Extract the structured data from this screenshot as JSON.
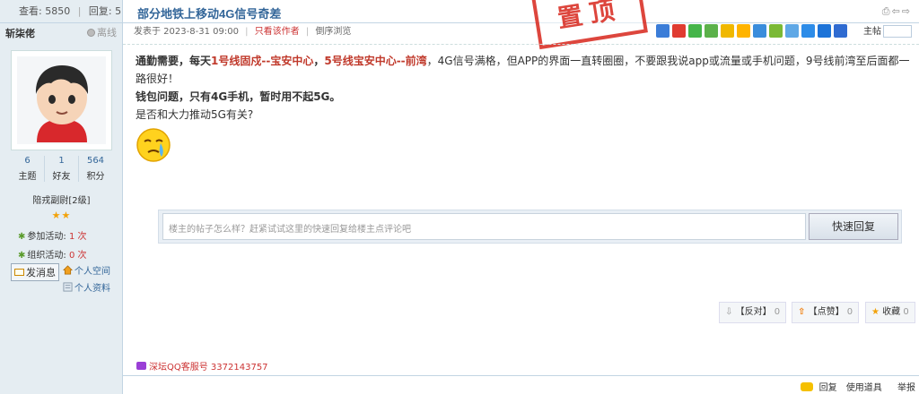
{
  "stats": {
    "views_label": "查看",
    "views": "5850",
    "replies_label": "回复",
    "replies": "5"
  },
  "user": {
    "name": "斩柒佬",
    "status": "离线",
    "counts": [
      {
        "value": "6",
        "label": "主题"
      },
      {
        "value": "1",
        "label": "好友"
      },
      {
        "value": "564",
        "label": "积分"
      }
    ],
    "rank": "陪戎副尉[2级]",
    "stars": "★★",
    "activity_join_label": "参加活动:",
    "activity_join_value": "1 次",
    "activity_org_label": "组织活动:",
    "activity_org_value": "0 次",
    "send_msg": "发消息",
    "space": "个人空间",
    "profile": "个人资料"
  },
  "thread": {
    "title_prefix": "部分地铁上移动",
    "title_bold": "4G",
    "title_suffix": "信号奇差",
    "stamp": "置顶",
    "posted": "发表于 2023-8-31 09:00",
    "only_author": "只看该作者",
    "reverse": "倒序浏览",
    "floor": "主帖"
  },
  "post": {
    "p1_a": "通勤需要，每天",
    "p1_b": "1号线固戍--宝安中心",
    "p1_c": "，",
    "p1_d": "5号线宝安中心--前湾",
    "p1_e": "，4G信号满格，但APP的界面一直转圈圈，不要跟我说app或流量或手机问题，9号线前湾至后面都一路很好！",
    "p2": "钱包问题，只有4G手机，暂时用不起5G。",
    "p3": "是否和大力推动5G有关?"
  },
  "reply": {
    "placeholder": "楼主的帖子怎么样？赶紧试试这里的快速回复给楼主点评论吧",
    "button": "快速回复"
  },
  "actions": {
    "oppose": "【反对】",
    "oppose_count": "0",
    "support": "【点赞】",
    "support_count": "0",
    "fav": "收藏",
    "fav_count": "0"
  },
  "qq_service": "深坛QQ客服号 3372143757",
  "bottom": {
    "reply": "回复",
    "tools": "使用道具",
    "report": "举报"
  },
  "colors": {
    "accent": "#336699",
    "stamp": "#d8261c",
    "highlight": "#c0392b"
  }
}
